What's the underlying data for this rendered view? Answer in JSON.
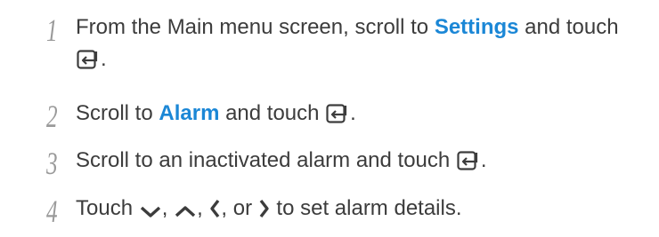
{
  "steps": [
    {
      "number": "1",
      "line1_pre": "From the Main menu screen, scroll to ",
      "keyword": "Settings",
      "line1_post": " and touch",
      "line2_post": "."
    },
    {
      "number": "2",
      "pre": "Scroll to ",
      "keyword": "Alarm",
      "mid": " and touch ",
      "post": "."
    },
    {
      "number": "3",
      "pre": "Scroll to an inactivated alarm and touch ",
      "post": "."
    },
    {
      "number": "4",
      "pre": "Touch ",
      "sep1": ", ",
      "sep2": ", ",
      "sep3": ", or ",
      "post": " to set alarm details."
    }
  ],
  "colors": {
    "text": "#3c3c3c",
    "keyword": "#1b87d6",
    "step_number": "#9a9a9a"
  },
  "icons": [
    "enter-icon",
    "down-arrow-icon",
    "up-arrow-icon",
    "left-arrow-icon",
    "right-arrow-icon"
  ]
}
